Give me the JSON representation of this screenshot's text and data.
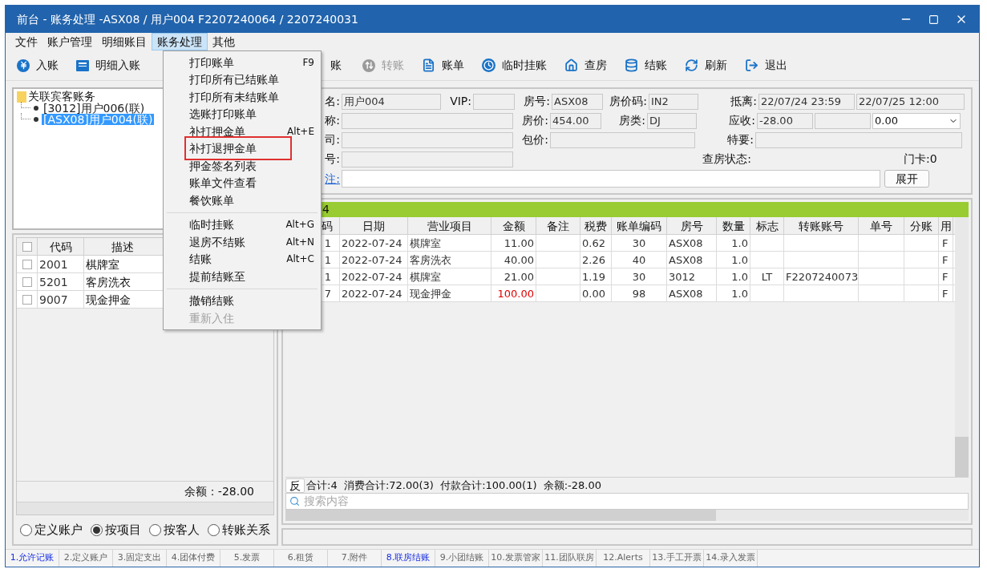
{
  "window": {
    "title": "前台 - 账务处理 -ASX08 / 用户004  F2207240064 / 2207240031"
  },
  "menu_bar": [
    {
      "label": "文件",
      "selected": false
    },
    {
      "label": "账户管理",
      "selected": false
    },
    {
      "label": "明细账目",
      "selected": false
    },
    {
      "label": "账务处理",
      "selected": true
    },
    {
      "label": "其他",
      "selected": false
    }
  ],
  "toolbar": [
    {
      "label": "入账",
      "kind": "yen",
      "disabled": false
    },
    {
      "label": "明细入账",
      "kind": "ledger",
      "disabled": false
    },
    {
      "label": "账",
      "kind": "covered",
      "disabled": false
    },
    {
      "label": "转账",
      "kind": "transfer",
      "disabled": true
    },
    {
      "label": "账单",
      "kind": "bill",
      "disabled": false
    },
    {
      "label": "临时挂账",
      "kind": "clock",
      "disabled": false
    },
    {
      "label": "查房",
      "kind": "house",
      "disabled": false
    },
    {
      "label": "结账",
      "kind": "database",
      "disabled": false
    },
    {
      "label": "刷新",
      "kind": "refresh",
      "disabled": false
    },
    {
      "label": "退出",
      "kind": "exit",
      "disabled": false
    }
  ],
  "dropdown_menu": {
    "groups": [
      [
        {
          "label": "打印账单",
          "shortcut": "F9",
          "disabled": false,
          "outlined": false
        },
        {
          "label": "打印所有已结账单",
          "disabled": false,
          "outlined": false
        },
        {
          "label": "打印所有未结账单",
          "disabled": false,
          "outlined": false
        },
        {
          "label": "选账打印账单",
          "disabled": false,
          "outlined": false
        },
        {
          "label": "补打押金单",
          "shortcut": "Alt+E",
          "disabled": false,
          "outlined": false
        },
        {
          "label": "补打退押金单",
          "disabled": false,
          "outlined": true
        },
        {
          "label": "押金签名列表",
          "disabled": false,
          "outlined": false
        },
        {
          "label": "账单文件查看",
          "disabled": false,
          "outlined": false
        },
        {
          "label": "餐饮账单",
          "disabled": false,
          "outlined": false
        }
      ],
      [
        {
          "label": "临时挂账",
          "shortcut": "Alt+G",
          "disabled": false,
          "outlined": false
        },
        {
          "label": "退房不结账",
          "shortcut": "Alt+N",
          "disabled": false,
          "outlined": false
        },
        {
          "label": "结账",
          "shortcut": "Alt+C",
          "disabled": false,
          "outlined": false
        },
        {
          "label": "提前结账至",
          "disabled": false,
          "outlined": false
        }
      ],
      [
        {
          "label": "撤销结账",
          "disabled": false,
          "outlined": false
        },
        {
          "label": "重新入住",
          "disabled": true,
          "outlined": false
        }
      ]
    ]
  },
  "tree": {
    "label": "关联宾客账务",
    "children": [
      {
        "label": "[3012]用户006(联)",
        "selected": false
      },
      {
        "label": "[ASX08]用户004(联)",
        "selected": true
      }
    ]
  },
  "item_table": {
    "columns": [
      "代码",
      "描述"
    ],
    "rows": [
      {
        "checked": false,
        "code": "2001",
        "description": "棋牌室"
      },
      {
        "checked": false,
        "code": "5201",
        "description": "客房洗衣"
      },
      {
        "checked": false,
        "code": "9007",
        "description": "现金押金"
      }
    ],
    "header_checked": false,
    "balance": "余额：-28.00"
  },
  "group_by": [
    {
      "label": "定义账户",
      "selected": false
    },
    {
      "label": "按项目",
      "selected": true
    },
    {
      "label": "按客人",
      "selected": false
    },
    {
      "label": "转账关系",
      "selected": false
    }
  ],
  "guest_form": {
    "name": {
      "label": "名:",
      "value": "用户004"
    },
    "vip": {
      "label": "VIP:"
    },
    "room": {
      "label": "房号:",
      "value": "ASX08"
    },
    "rate_code": {
      "label": "房价码:",
      "value": "IN2"
    },
    "stay": {
      "label": "抵离:",
      "arrival": "22/07/24 23:59",
      "departure": "22/07/25 12:00"
    },
    "company_name": {
      "label": "称:"
    },
    "rate": {
      "label": "房价:",
      "value": "454.00"
    },
    "room_type": {
      "label": "房类:",
      "value": "DJ"
    },
    "receivable": {
      "label": "应收:",
      "value": "-28.00",
      "select_value": "0.00"
    },
    "agency": {
      "label": "司:"
    },
    "package": {
      "label": "包价:"
    },
    "special": {
      "label": "特要:"
    },
    "number": {
      "label": "号:"
    },
    "inspection_status": {
      "label": "查房状态:"
    },
    "key_card": "门卡:0",
    "remark": {
      "label": "注:"
    },
    "expand_button": "展开"
  },
  "transactions": {
    "header_bar": "4",
    "columns": [
      "码",
      "日期",
      "营业项目",
      "金额",
      "备注",
      "税费",
      "账单编码",
      "房号",
      "数量",
      "标志",
      "转账账号",
      "单号",
      "分账",
      "用"
    ],
    "rows": [
      {
        "kind": "charge",
        "code": "1",
        "date": "2022-07-24",
        "item": "棋牌室",
        "amount": "11.00",
        "tax": "0.62",
        "bill_code": "30",
        "room": "ASX08",
        "qty": "1.0",
        "column_14": "F"
      },
      {
        "kind": "charge",
        "code": "1",
        "date": "2022-07-24",
        "item": "客房洗衣",
        "amount": "40.00",
        "tax": "2.26",
        "bill_code": "40",
        "room": "ASX08",
        "qty": "1.0",
        "column_14": "F"
      },
      {
        "kind": "charge",
        "code": "1",
        "date": "2022-07-24",
        "item": "棋牌室",
        "amount": "21.00",
        "tax": "1.19",
        "bill_code": "30",
        "room": "3012",
        "qty": "1.0",
        "flag": "LT",
        "transfer_account": "F2207240073",
        "column_14": "F"
      },
      {
        "kind": "payment",
        "code": "7",
        "date": "2022-07-24",
        "item": "现金押金",
        "amount": "100.00",
        "tax": "0.00",
        "bill_code": "98",
        "room": "ASX08",
        "qty": "1.0",
        "column_14": "F"
      }
    ],
    "reverse_button": "反",
    "summary": "合计:4  消费合计:72.00(3)  付款合计:100.00(1)  余额:-28.00",
    "search": {
      "placeholder": "搜索内容"
    }
  },
  "bottom_tabs": [
    {
      "label": "1.允许记账",
      "highlighted": true
    },
    {
      "label": "2.定义账户",
      "highlighted": false
    },
    {
      "label": "3.固定支出",
      "highlighted": false
    },
    {
      "label": "4.团体付费",
      "highlighted": false
    },
    {
      "label": "5.发票",
      "highlighted": false
    },
    {
      "label": "6.租赁",
      "highlighted": false
    },
    {
      "label": "7.附件",
      "highlighted": false
    },
    {
      "label": "8.联房结账",
      "highlighted": true
    },
    {
      "label": "9.小团结账",
      "highlighted": false
    },
    {
      "label": "10.发票管家",
      "highlighted": false
    },
    {
      "label": "11.团队联房",
      "highlighted": false
    },
    {
      "label": "12.Alerts",
      "highlighted": false
    },
    {
      "label": "13.手工开票",
      "highlighted": false
    },
    {
      "label": "14.录入发票",
      "highlighted": false
    }
  ]
}
